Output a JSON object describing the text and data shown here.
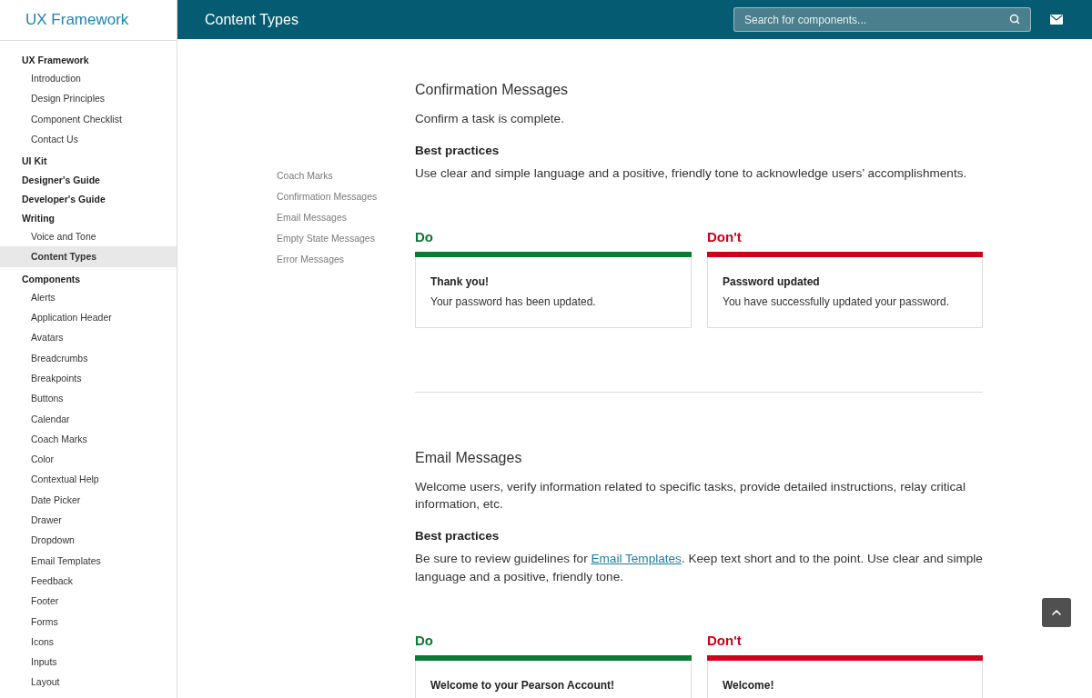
{
  "sidebar": {
    "brand": "UX Framework",
    "nav": [
      {
        "label": "UX Framework",
        "selected": false,
        "children": [
          {
            "label": "Introduction",
            "selected": false
          },
          {
            "label": "Design Principles",
            "selected": false
          },
          {
            "label": "Component Checklist",
            "selected": false
          },
          {
            "label": "Contact Us",
            "selected": false
          }
        ]
      },
      {
        "label": "UI Kit",
        "selected": false
      },
      {
        "label": "Designer's Guide",
        "selected": false
      },
      {
        "label": "Developer's Guide",
        "selected": false
      },
      {
        "label": "Writing",
        "selected": false,
        "children": [
          {
            "label": "Voice and Tone",
            "selected": false
          },
          {
            "label": "Content Types",
            "selected": true
          }
        ]
      },
      {
        "label": "Components",
        "selected": false,
        "children": [
          {
            "label": "Alerts",
            "selected": false
          },
          {
            "label": "Application Header",
            "selected": false
          },
          {
            "label": "Avatars",
            "selected": false
          },
          {
            "label": "Breadcrumbs",
            "selected": false
          },
          {
            "label": "Breakpoints",
            "selected": false
          },
          {
            "label": "Buttons",
            "selected": false
          },
          {
            "label": "Calendar",
            "selected": false
          },
          {
            "label": "Coach Marks",
            "selected": false
          },
          {
            "label": "Color",
            "selected": false
          },
          {
            "label": "Contextual Help",
            "selected": false
          },
          {
            "label": "Date Picker",
            "selected": false
          },
          {
            "label": "Drawer",
            "selected": false
          },
          {
            "label": "Dropdown",
            "selected": false
          },
          {
            "label": "Email Templates",
            "selected": false
          },
          {
            "label": "Feedback",
            "selected": false
          },
          {
            "label": "Footer",
            "selected": false
          },
          {
            "label": "Forms",
            "selected": false
          },
          {
            "label": "Icons",
            "selected": false
          },
          {
            "label": "Inputs",
            "selected": false
          },
          {
            "label": "Layout",
            "selected": false
          }
        ]
      }
    ]
  },
  "top_bar": {
    "title": "Content Types",
    "search": {
      "placeholder": "Search for components..."
    }
  },
  "page_nav": [
    {
      "label": "Coach Marks"
    },
    {
      "label": "Confirmation Messages"
    },
    {
      "label": "Email Messages"
    },
    {
      "label": "Empty State Messages"
    },
    {
      "label": "Error Messages"
    }
  ],
  "sections": [
    {
      "title": "Confirmation Messages",
      "description": "Confirm a task is complete.",
      "best_practices_heading": "Best practices",
      "best_practices": [
        {
          "kind": "text",
          "text": "Use clear and simple language and a positive, friendly tone to acknowledge users’ accomplishments."
        }
      ],
      "examples": [
        {
          "kind": "do",
          "label": "Do",
          "title": "Thank you!",
          "text": "Your password has been updated."
        },
        {
          "kind": "dont",
          "label": "Don't",
          "title": "Password updated",
          "text": "You have successfully updated your password."
        }
      ]
    },
    {
      "title": "Email Messages",
      "description": "Welcome users, verify information related to specific tasks, provide detailed instructions, relay critical information, etc.",
      "best_practices_heading": "Best practices",
      "best_practices": [
        {
          "kind": "text",
          "text": "Be sure to review guidelines for "
        },
        {
          "kind": "link",
          "text": "Email Templates"
        },
        {
          "kind": "text",
          "text": ". Keep text short and to the point. Use clear and simple language and a positive, friendly tone."
        }
      ],
      "examples": [
        {
          "kind": "do",
          "label": "Do",
          "title": "Welcome to your Pearson Account!"
        },
        {
          "kind": "dont",
          "label": "Don't",
          "title": "Welcome!"
        }
      ]
    }
  ]
}
